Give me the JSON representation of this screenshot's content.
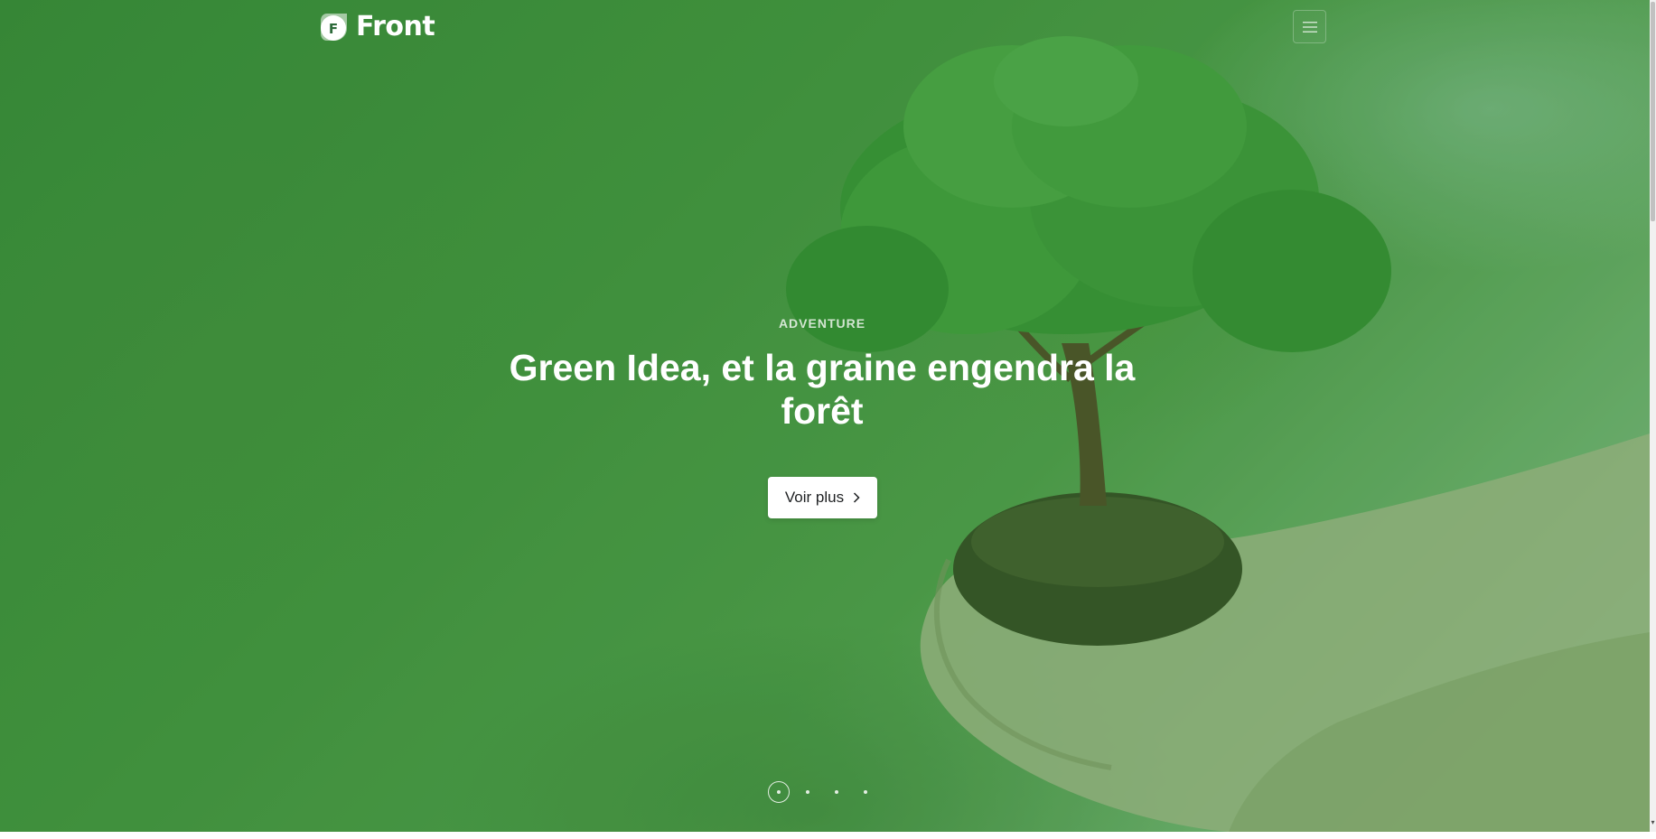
{
  "brand": {
    "name": "Front",
    "mark_letter": "F"
  },
  "header": {
    "menu_icon": "hamburger-icon"
  },
  "hero": {
    "eyebrow": "ADVENTURE",
    "headline": "Green Idea, et la graine engendra la forêt",
    "cta_label": "Voir plus",
    "cta_icon": "chevron-right-icon",
    "image": "tree-growing-from-soil-in-cupped-hands",
    "slides_total": 4,
    "active_slide": 1
  },
  "colors": {
    "accent": "#377dff",
    "overlay_green": "#3f8f3d",
    "text_on_image": "#ffffff",
    "button_text": "#1e2022"
  }
}
